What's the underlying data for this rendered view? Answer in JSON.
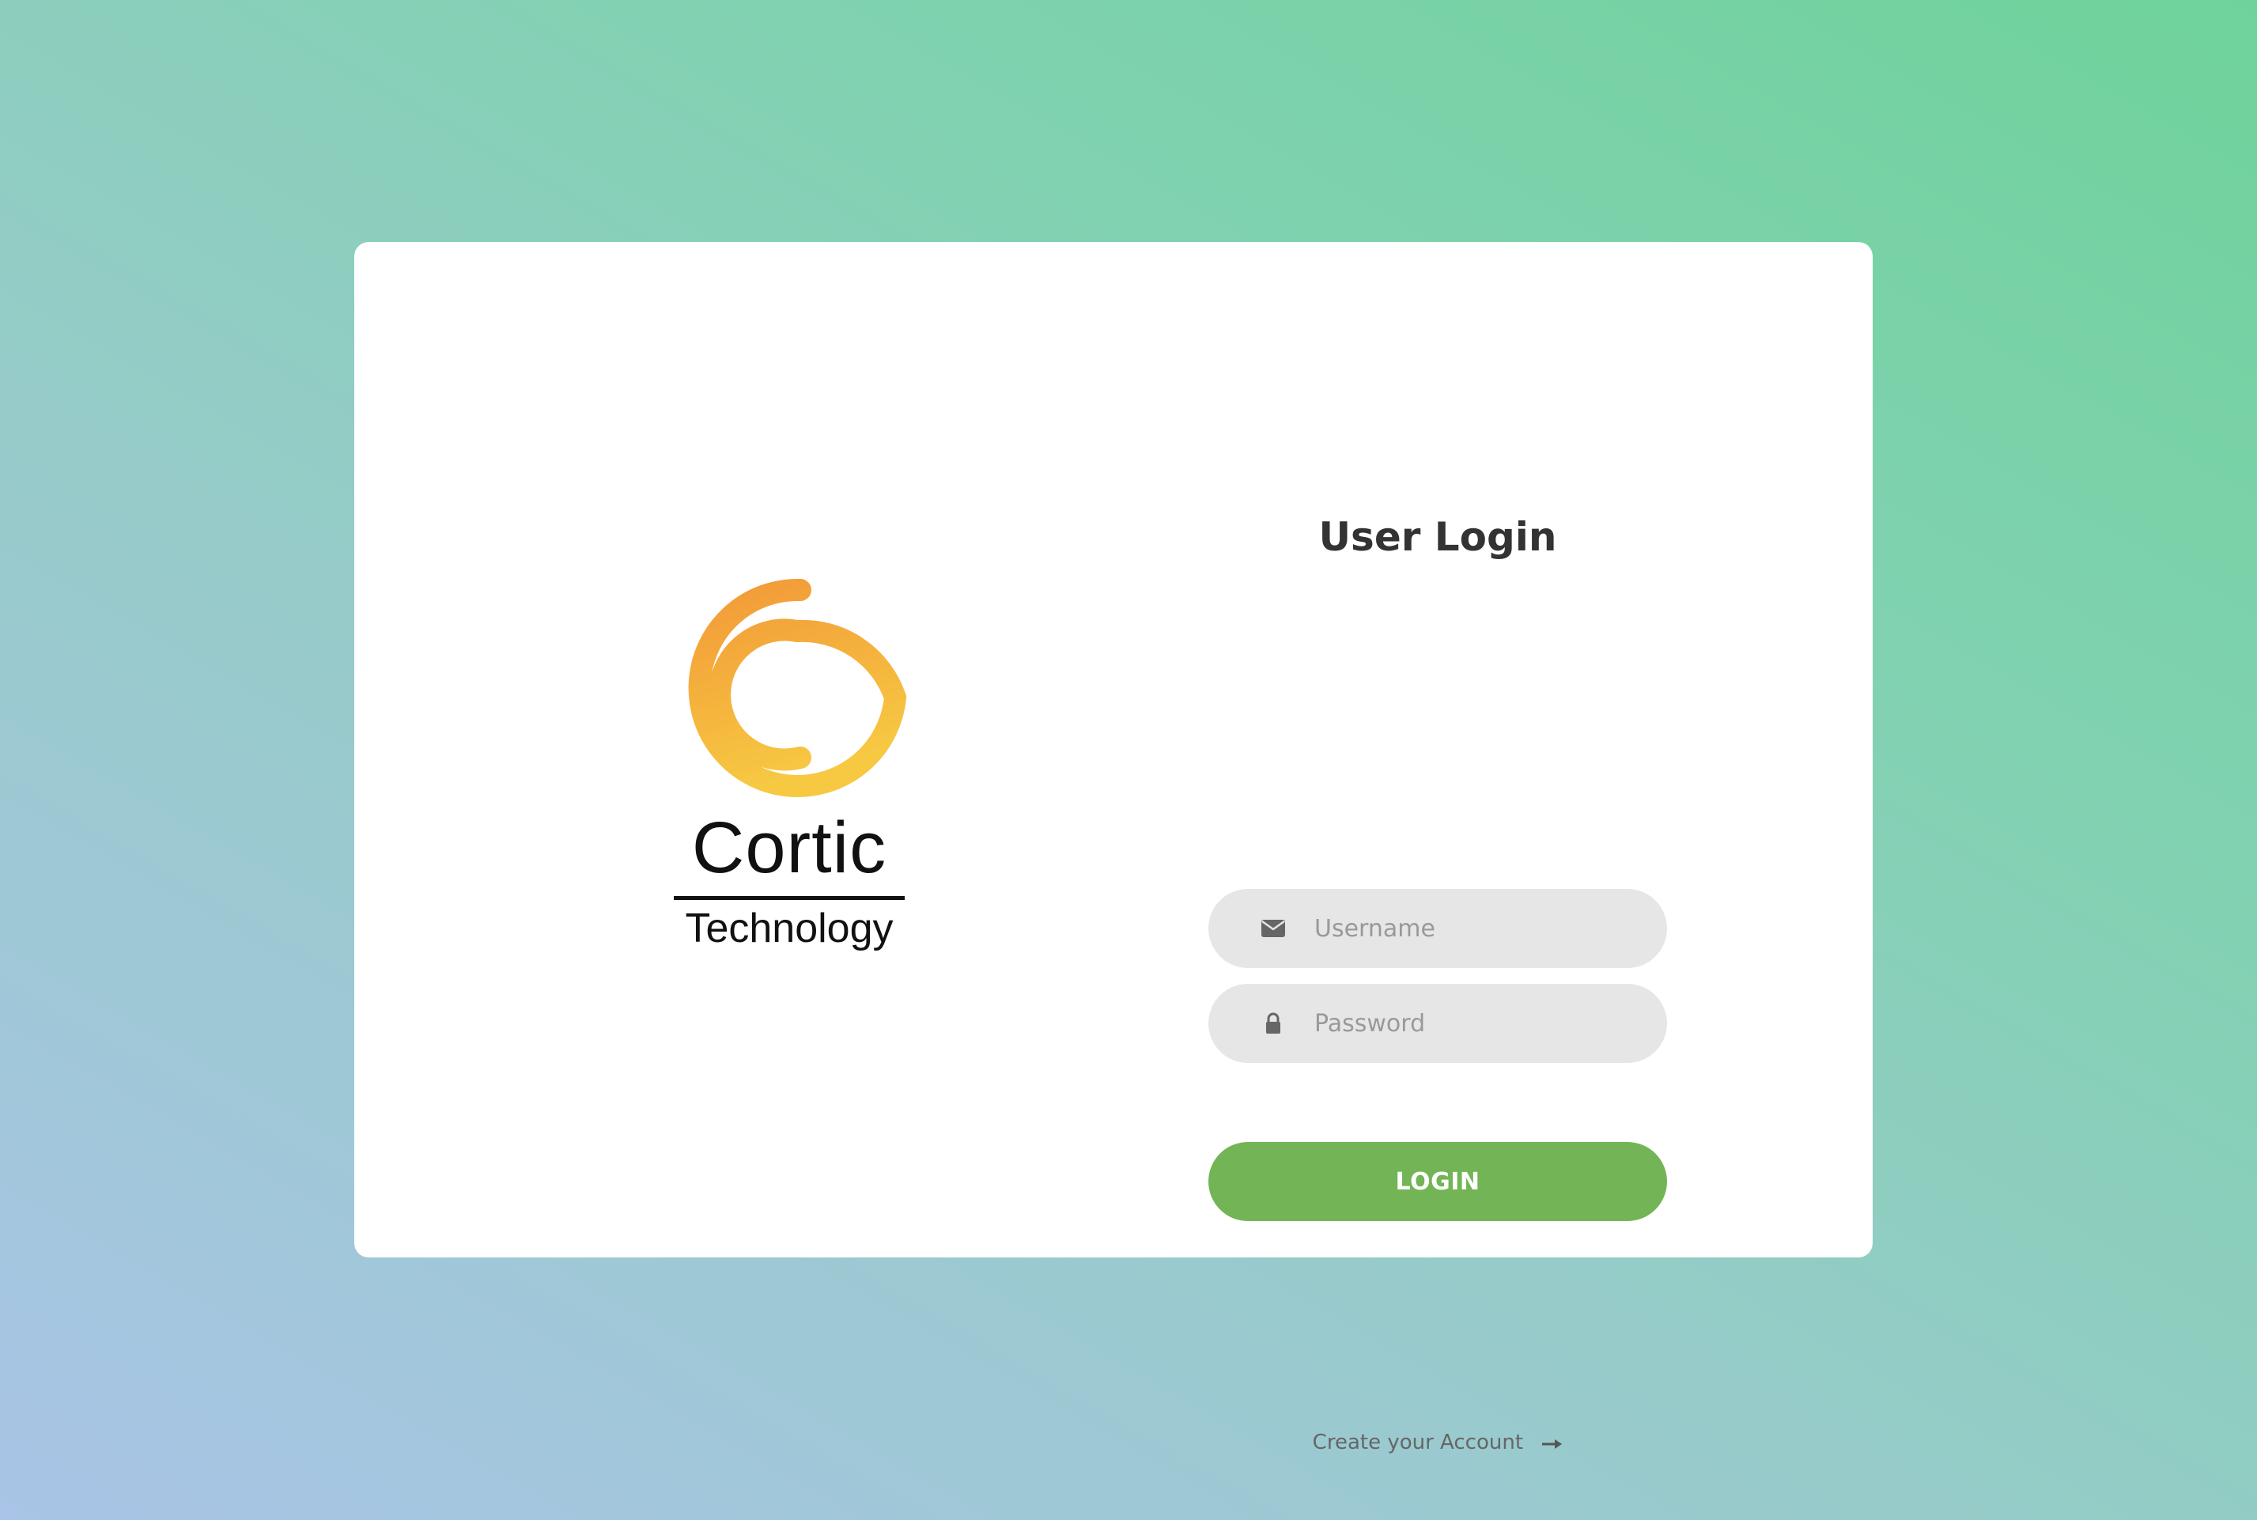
{
  "brand": {
    "name": "Cortic",
    "subtitle": "Technology",
    "logo_icon": "spiral-logo-icon",
    "logo_colors": [
      "#f29a38",
      "#f7c842"
    ]
  },
  "login": {
    "title": "User Login",
    "username": {
      "placeholder": "Username",
      "value": "",
      "icon": "envelope-icon"
    },
    "password": {
      "placeholder": "Password",
      "value": "",
      "icon": "lock-icon"
    },
    "submit_label": "LOGIN",
    "create_account_label": "Create your Account",
    "create_account_icon": "arrow-right-icon"
  },
  "colors": {
    "accent": "#73b556",
    "field_bg": "#e6e6e6",
    "title": "#333333"
  }
}
